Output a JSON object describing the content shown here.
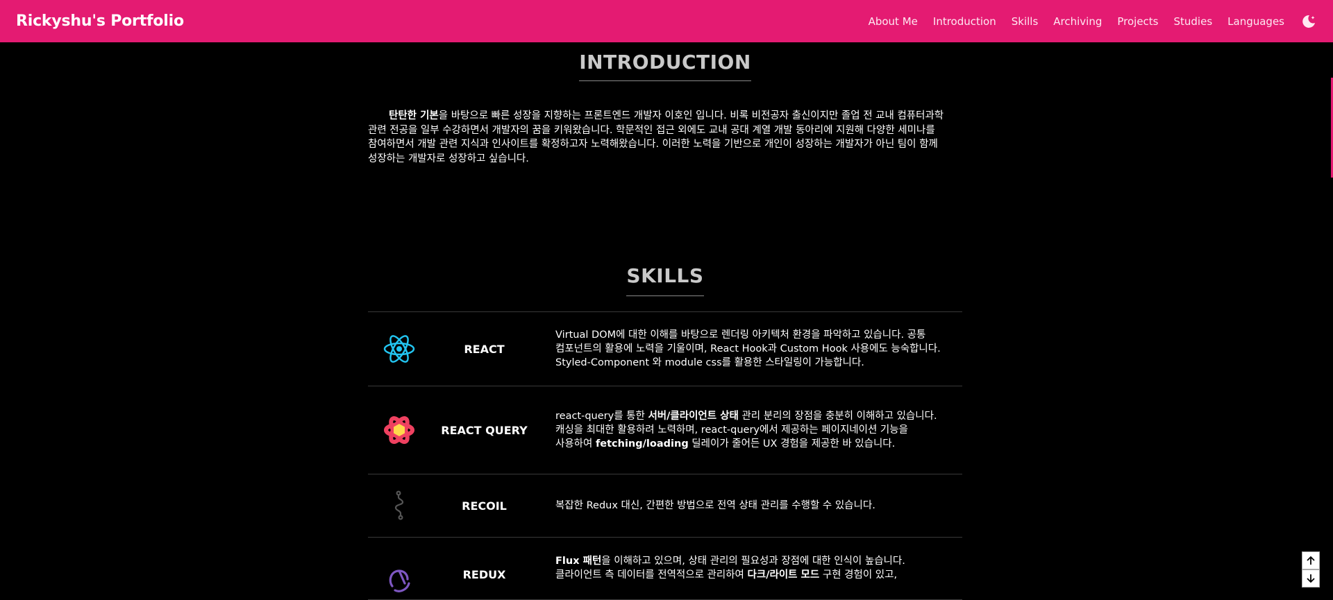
{
  "navbar": {
    "brand": "Rickyshu's Portfolio",
    "links": [
      "About Me",
      "Introduction",
      "Skills",
      "Archiving",
      "Projects",
      "Studies",
      "Languages"
    ],
    "theme_icon": "moon-icon",
    "background_color": "#e41b72"
  },
  "introduction": {
    "title": "INTRODUCTION",
    "text_bold": "탄탄한 기본",
    "text_rest": "을 바탕으로 빠른 성장을 지향하는 프론트엔드 개발자 이호인 입니다. 비록 비전공자 출신이지만 졸업 전 교내 컴퓨터과학 관련 전공을 일부 수강하면서 개발자의 꿈을 키워왔습니다. 학문적인 접근 외에도 교내 공대 계열 개발 동아리에 지원해 다양한 세미나를 참여하면서 개발 관련 지식과 인사이트를 확정하고자 노력해왔습니다. 이러한 노력을 기반으로 개인이 성장하는 개발자가 아닌 팀이 함께 성장하는 개발자로 성장하고 싶습니다."
  },
  "skills": {
    "title": "SKILLS",
    "items": [
      {
        "name": "REACT",
        "icon": "react-icon",
        "desc": "Virtual DOM에 대한 이해를 바탕으로 렌더링 아키텍처 환경을 파악하고 있습니다. 공통 컴포넌트의 활용에 노력을 기울이며, React Hook과 Custom Hook 사용에도 능숙합니다. Styled-Component 와 module css를 활용한 스타일링이 가능합니다."
      },
      {
        "name": "REACT QUERY",
        "icon": "react-query-icon",
        "desc_1": "react-query를 통한 ",
        "desc_bold_1": "서버/클라이언트 상태",
        "desc_2": " 관리 분리의 장점을 충분히 이해하고 있습니다. 캐싱을 최대한 활용하려 노력하며, react-query에서 제공하는 페이지네이션 기능을 사용하여 ",
        "desc_bold_2": "fetching/loading",
        "desc_3": " 딜레이가 줄어든 UX 경험을 제공한 바 있습니다."
      },
      {
        "name": "RECOIL",
        "icon": "recoil-icon",
        "desc": "복잡한 Redux 대신, 간편한 방법으로 전역 상태 관리를 수행할 수 있습니다."
      },
      {
        "name": "REDUX",
        "icon": "redux-icon",
        "desc_bold_1": "Flux 패턴",
        "desc_1": "을 이해하고 있으며, 상태 관리의 필요성과 장점에 대한 인식이 높습니다. 클라이언트 측 데이터를 전역적으로 관리하여 ",
        "desc_bold_2": "다크/라이트 모드",
        "desc_2": " 구현 경험이 있고,"
      }
    ]
  },
  "scroll_controls": {
    "up_icon": "arrow-up-icon",
    "down_icon": "arrow-down-icon"
  }
}
